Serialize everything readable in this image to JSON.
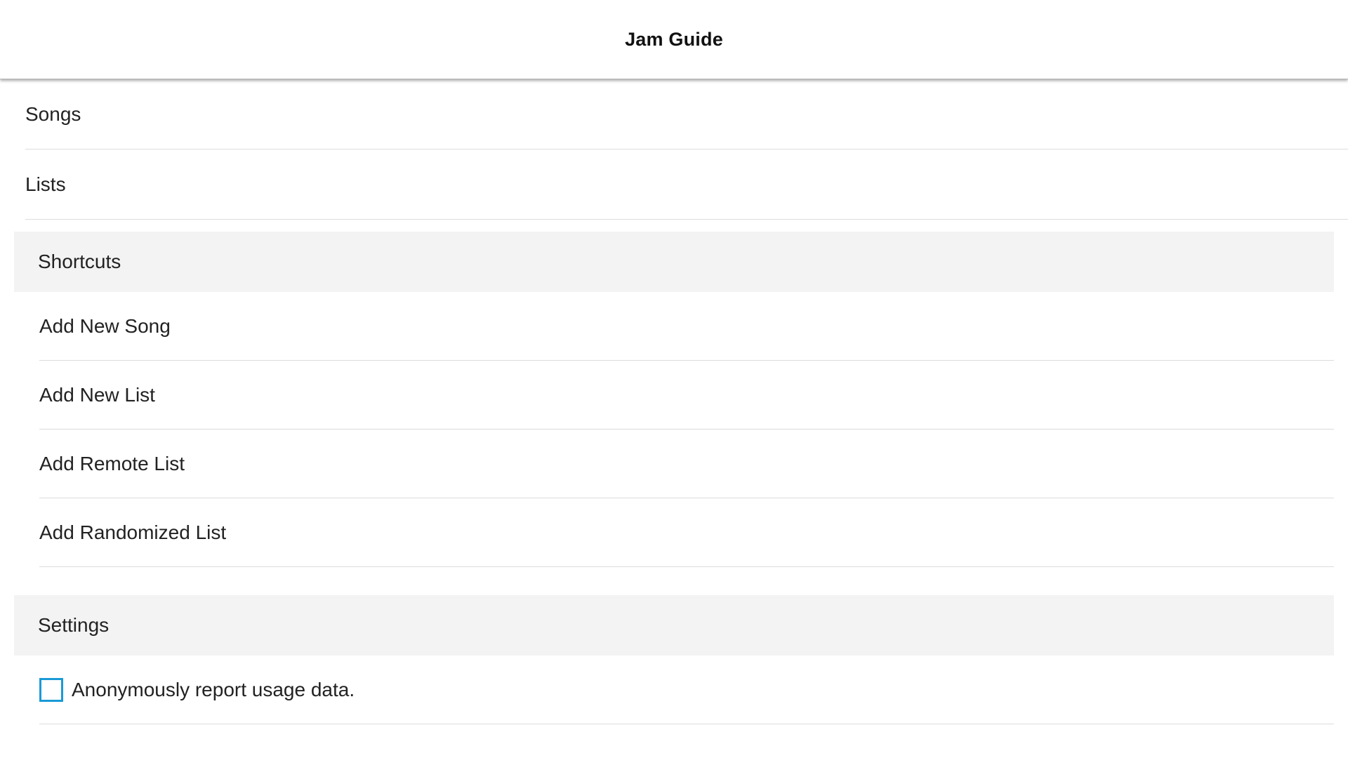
{
  "app": {
    "title": "Jam Guide"
  },
  "nav": {
    "items": [
      {
        "label": "Songs"
      },
      {
        "label": "Lists"
      }
    ]
  },
  "shortcuts": {
    "header": "Shortcuts",
    "items": [
      {
        "label": "Add New Song"
      },
      {
        "label": "Add New List"
      },
      {
        "label": "Add Remote List"
      },
      {
        "label": "Add Randomized List"
      }
    ]
  },
  "settings": {
    "header": "Settings",
    "usage_data": {
      "label": "Anonymously report usage data.",
      "checked": false
    }
  },
  "colors": {
    "checkbox_border": "#1a9ad6",
    "section_background": "#f3f3f3"
  }
}
